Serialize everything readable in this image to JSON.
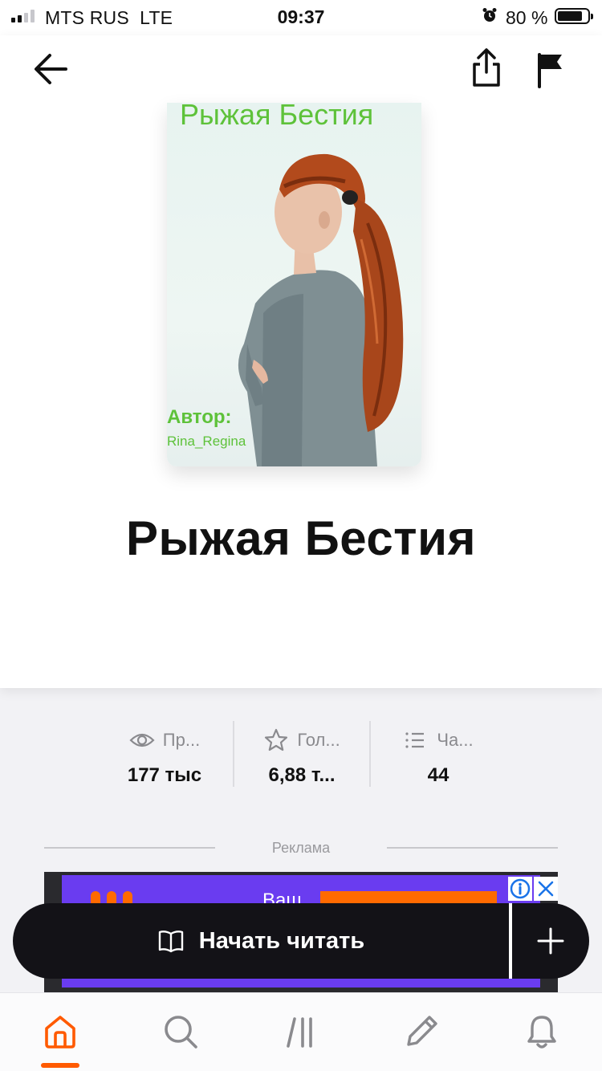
{
  "status_bar": {
    "carrier": "MTS RUS",
    "network": "LTE",
    "time": "09:37",
    "battery_percent": "80 %"
  },
  "header": {
    "back_icon": "arrow-left-icon",
    "share_icon": "share-icon",
    "report_icon": "flag-icon"
  },
  "cover": {
    "title": "Рыжая Бестия",
    "author_label": "Автор:",
    "author_name": "Rina_Regina"
  },
  "book": {
    "title": "Рыжая Бестия"
  },
  "stats": [
    {
      "icon": "eye-icon",
      "label": "Пр...",
      "value": "177 тыс"
    },
    {
      "icon": "star-icon",
      "label": "Гол...",
      "value": "6,88 т..."
    },
    {
      "icon": "list-icon",
      "label": "Ча...",
      "value": "44"
    }
  ],
  "ad": {
    "label": "Реклама",
    "headline_fragment": "Ваш"
  },
  "actions": {
    "read_label": "Начать читать",
    "read_icon": "open-book-icon",
    "add_icon": "plus-icon"
  },
  "tabbar": {
    "active": "home",
    "tabs": [
      {
        "name": "home",
        "icon": "home-icon"
      },
      {
        "name": "search",
        "icon": "search-icon"
      },
      {
        "name": "library",
        "icon": "library-icon"
      },
      {
        "name": "write",
        "icon": "pencil-icon"
      },
      {
        "name": "notifications",
        "icon": "bell-icon"
      }
    ]
  },
  "colors": {
    "accent": "#ff5a00",
    "cover_text": "#5ec23a",
    "read_bar": "#131217",
    "ad_purple": "#6a3cf0"
  }
}
